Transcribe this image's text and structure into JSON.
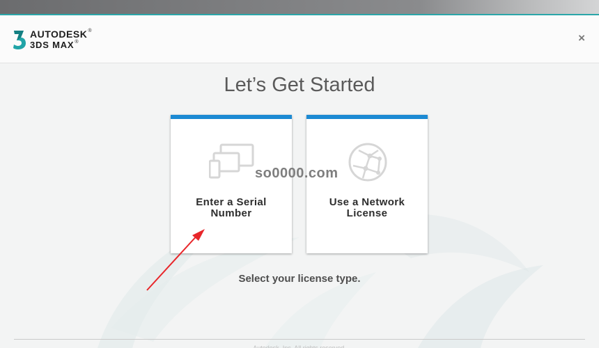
{
  "header": {
    "brand_top": "AUTODESK",
    "brand_bottom": "3DS MAX",
    "reg_symbol": "®",
    "close_glyph": "×"
  },
  "main": {
    "title": "Let’s Get Started",
    "subtitle": "Select your license type.",
    "options": [
      {
        "line1": "Enter a Serial",
        "line2": "Number",
        "icon": "devices-icon"
      },
      {
        "line1": "Use a Network",
        "line2": "License",
        "icon": "network-globe-icon"
      }
    ]
  },
  "watermark": "so0000.com",
  "footer": {
    "text": "Autodesk, Inc. All rights reserved."
  },
  "colors": {
    "accent": "#1c8ad3",
    "brand_teal": "#2aa6a9",
    "annotation_arrow": "#e8262a"
  }
}
